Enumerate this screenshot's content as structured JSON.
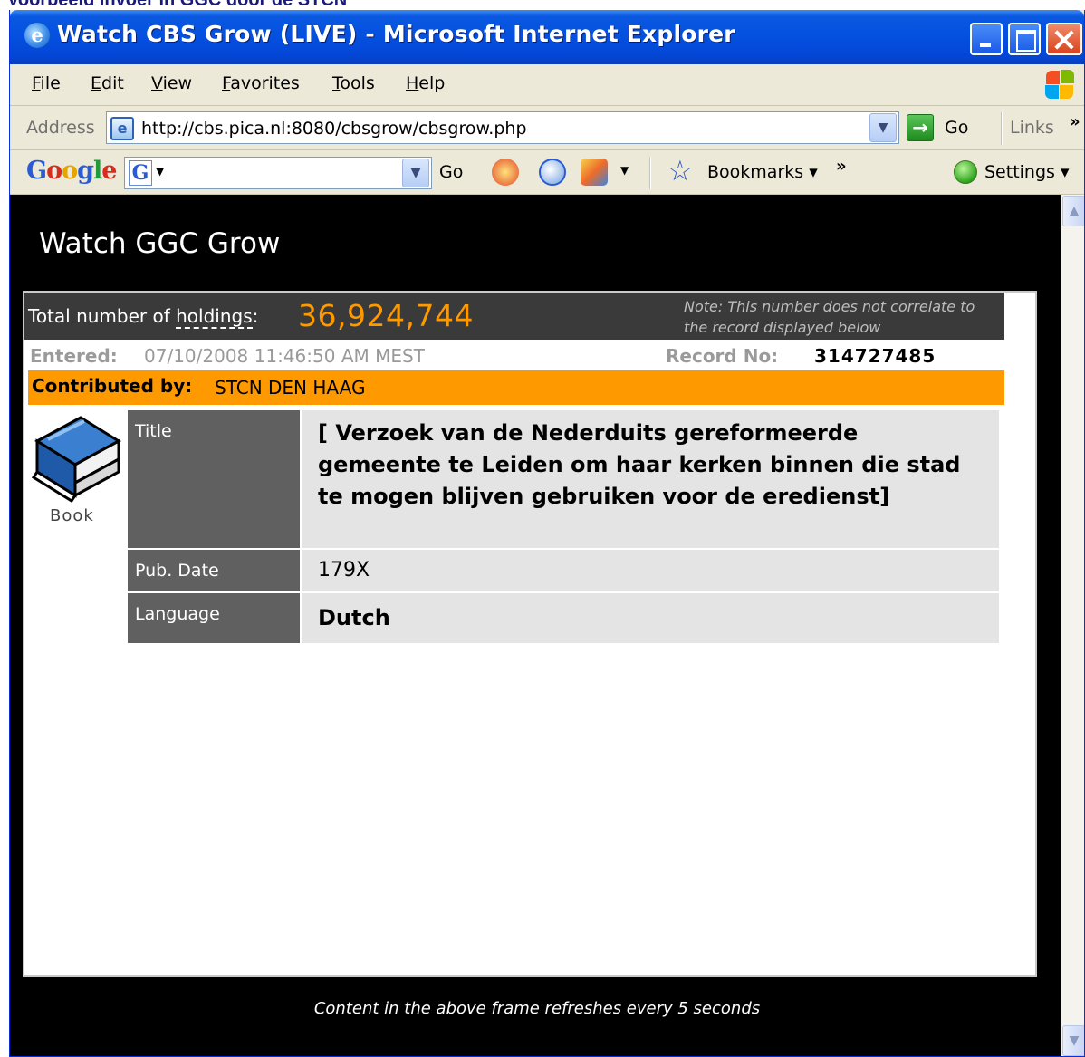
{
  "caption": "Voorbeeld invoer in GGC door de STCN",
  "window": {
    "title": "Watch CBS Grow (LIVE) - Microsoft Internet Explorer"
  },
  "menu": {
    "file": "File",
    "edit": "Edit",
    "view": "View",
    "favorites": "Favorites",
    "tools": "Tools",
    "help": "Help"
  },
  "address_bar": {
    "label": "Address",
    "url": "http://cbs.pica.nl:8080/cbsgrow/cbsgrow.php",
    "go_label": "Go",
    "links_label": "Links"
  },
  "google_toolbar": {
    "logo_letters": [
      "G",
      "o",
      "o",
      "g",
      "l",
      "e"
    ],
    "search_value": "",
    "go_label": "Go",
    "bookmarks_label": "Bookmarks",
    "settings_label": "Settings"
  },
  "page": {
    "title": "Watch GGC Grow",
    "holdings": {
      "label_prefix": "Total number of ",
      "label_abbr": "holdings",
      "label_suffix": ":",
      "count": "36,924,744",
      "note": "Note: This number does not correlate to the record displayed below"
    },
    "entered": {
      "label": "Entered:",
      "value": "07/10/2008 11:46:50 AM MEST"
    },
    "record_no": {
      "label": "Record No:",
      "value": "314727485"
    },
    "contributed_by": {
      "label": "Contributed by:",
      "value": "STCN DEN HAAG"
    },
    "material_type": "Book",
    "record": {
      "title_label": "Title",
      "title_value": "[ Verzoek van de Nederduits gereformeerde gemeente te Leiden om haar kerken binnen die stad te mogen blijven gebruiken voor de eredienst]",
      "pubdate_label": "Pub. Date",
      "pubdate_value": "179X",
      "language_label": "Language",
      "language_value": "Dutch"
    },
    "footer_note": "Content in the above frame refreshes every 5 seconds"
  },
  "colors": {
    "accent_orange": "#ff9900",
    "titlebar_blue": "#0551e0",
    "page_background": "#000000"
  },
  "icons": {
    "ie": "ie-page-icon",
    "book": "book-icon",
    "go": "go-arrow-icon",
    "bookmark": "star-icon",
    "settings": "green-dot-icon"
  }
}
